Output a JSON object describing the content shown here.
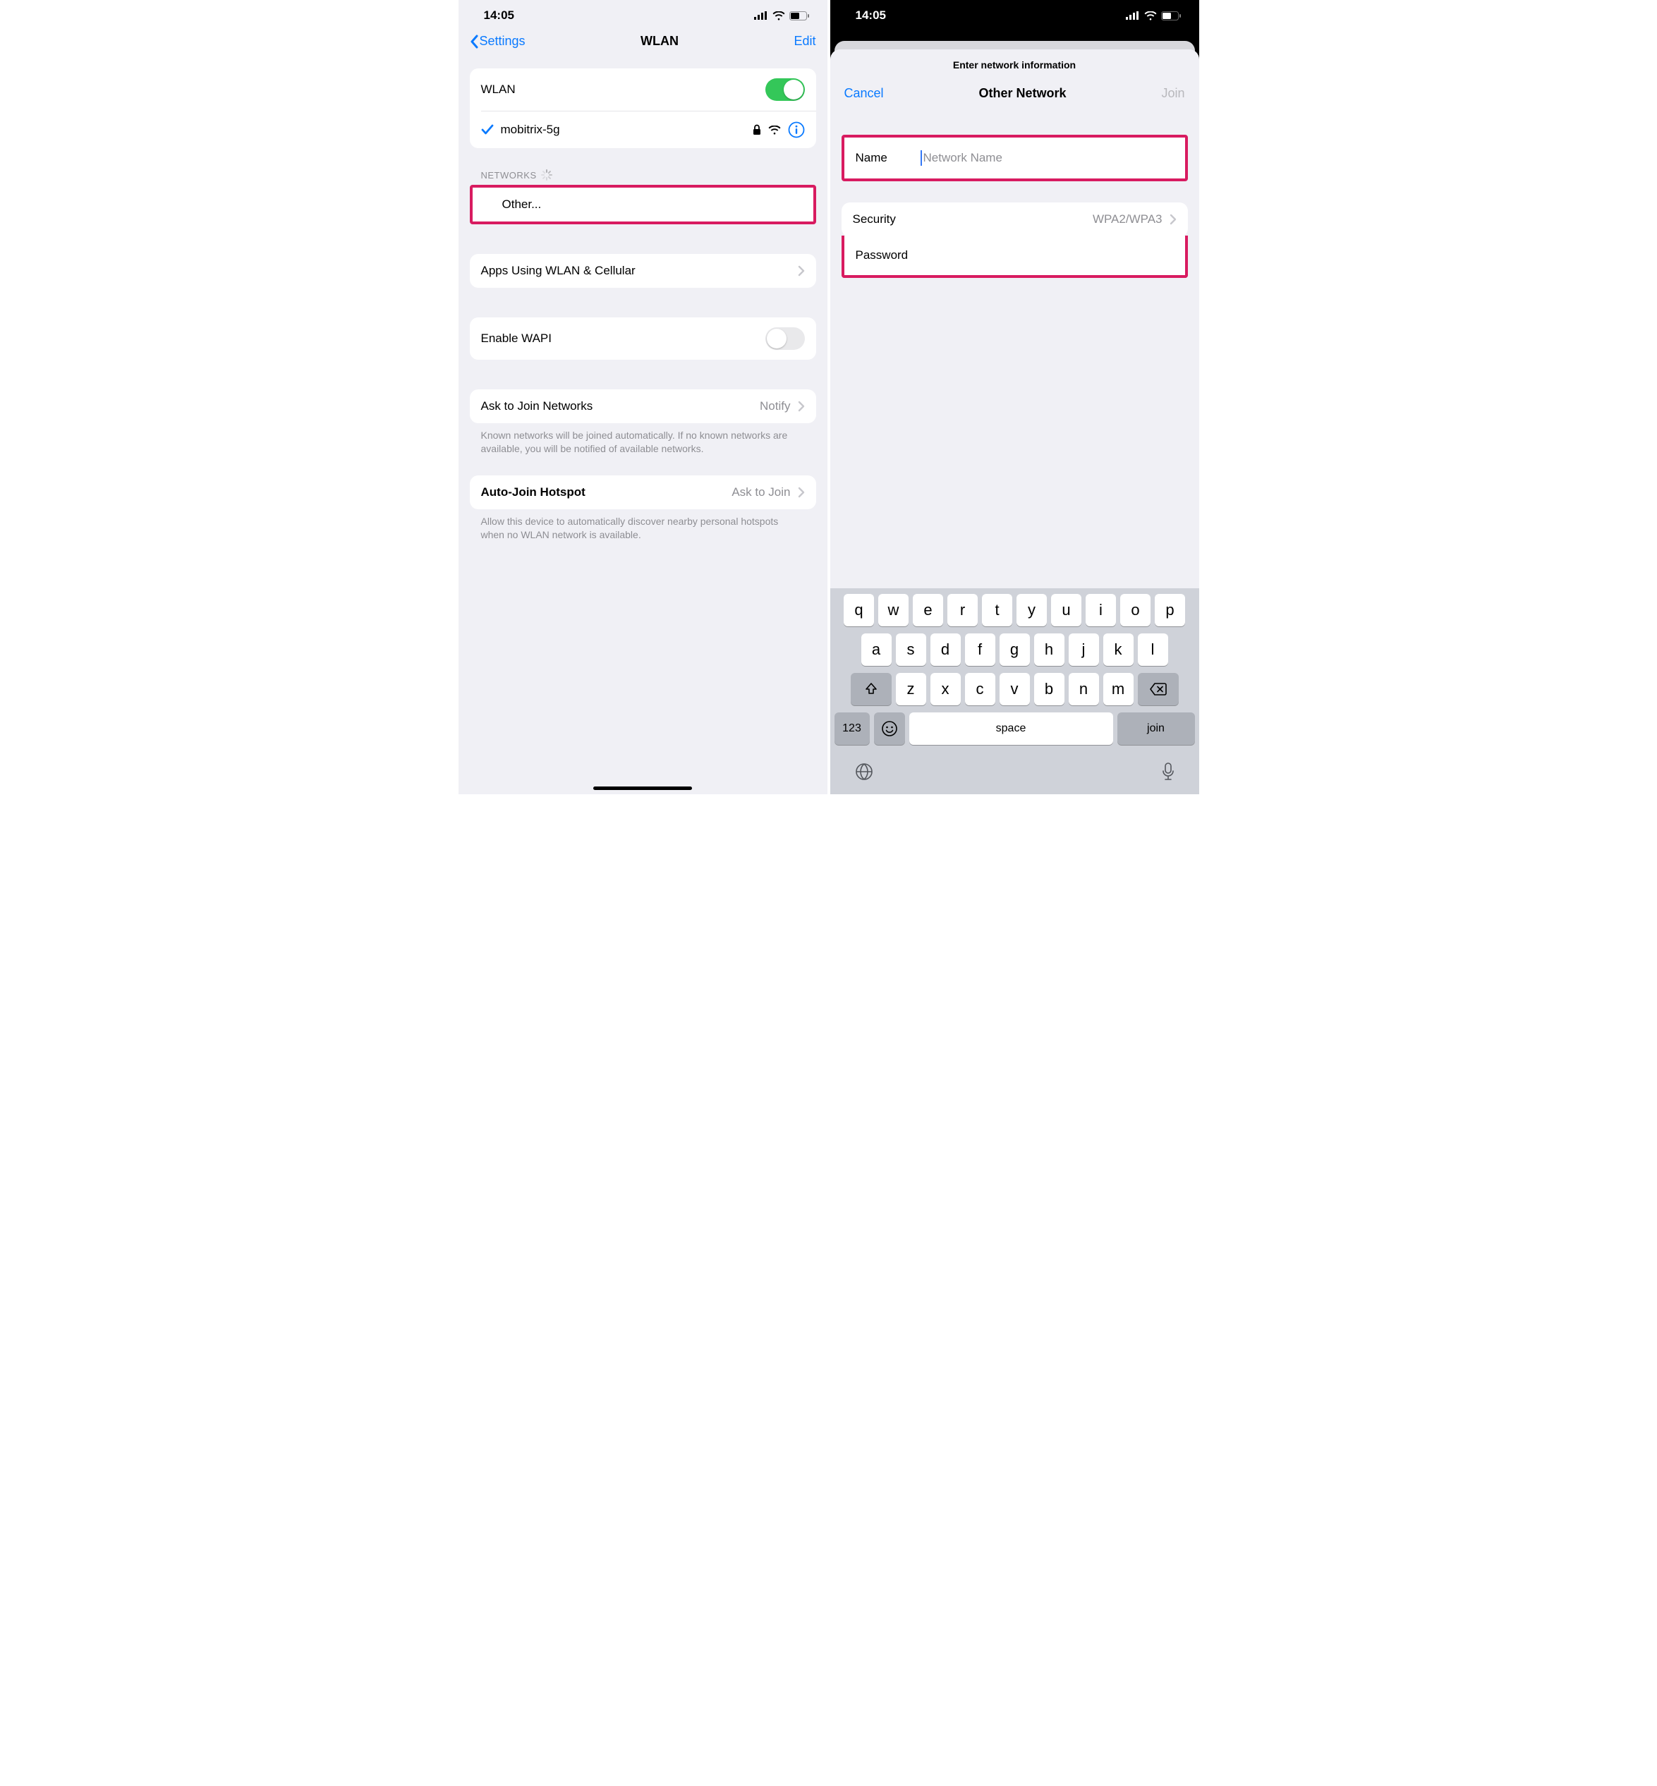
{
  "status": {
    "time": "14:05"
  },
  "phoneA": {
    "nav": {
      "back": "Settings",
      "title": "WLAN",
      "edit": "Edit"
    },
    "wlan": {
      "label": "WLAN",
      "on": true
    },
    "connected": {
      "name": "mobitrix-5g"
    },
    "networksHeader": "NETWORKS",
    "other": "Other...",
    "appsUsing": "Apps Using WLAN & Cellular",
    "enableWapi": "Enable WAPI",
    "askJoin": {
      "label": "Ask to Join Networks",
      "value": "Notify",
      "footer": "Known networks will be joined automatically. If no known networks are available, you will be notified of available networks."
    },
    "autoHotspot": {
      "label": "Auto-Join Hotspot",
      "value": "Ask to Join",
      "footer": "Allow this device to automatically discover nearby personal hotspots when no WLAN network is available."
    }
  },
  "phoneB": {
    "sheetTitle": "Enter network information",
    "nav": {
      "cancel": "Cancel",
      "title": "Other Network",
      "join": "Join"
    },
    "name": {
      "label": "Name",
      "placeholder": "Network Name"
    },
    "security": {
      "label": "Security",
      "value": "WPA2/WPA3"
    },
    "password": {
      "label": "Password"
    },
    "keyboard": {
      "row1": [
        "q",
        "w",
        "e",
        "r",
        "t",
        "y",
        "u",
        "i",
        "o",
        "p"
      ],
      "row2": [
        "a",
        "s",
        "d",
        "f",
        "g",
        "h",
        "j",
        "k",
        "l"
      ],
      "row3": [
        "z",
        "x",
        "c",
        "v",
        "b",
        "n",
        "m"
      ],
      "numKey": "123",
      "space": "space",
      "return": "join"
    }
  }
}
